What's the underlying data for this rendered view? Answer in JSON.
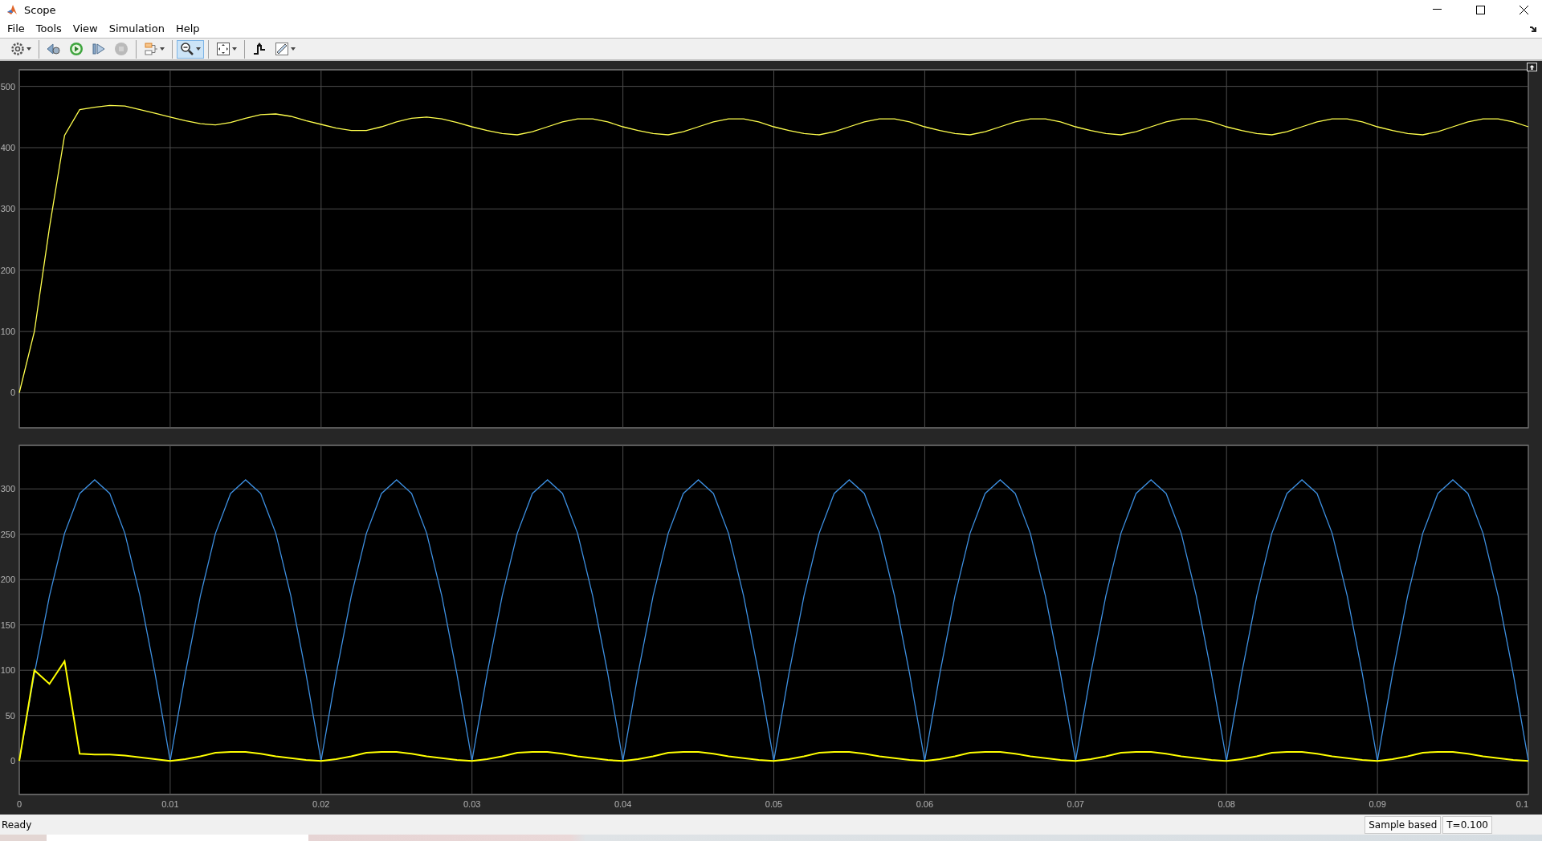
{
  "window": {
    "title": "Scope"
  },
  "menu": [
    "File",
    "Tools",
    "View",
    "Simulation",
    "Help"
  ],
  "toolbar_groups": [
    {
      "items": [
        {
          "kind": "settings",
          "dropdown": true,
          "selected": false,
          "disabled": false
        }
      ]
    },
    {
      "items": [
        {
          "kind": "step-back",
          "dropdown": false,
          "selected": false,
          "disabled": false
        },
        {
          "kind": "run",
          "dropdown": false,
          "selected": false,
          "disabled": false
        },
        {
          "kind": "step-forward",
          "dropdown": false,
          "selected": false,
          "disabled": false
        },
        {
          "kind": "stop",
          "dropdown": false,
          "selected": false,
          "disabled": true
        }
      ]
    },
    {
      "items": [
        {
          "kind": "signal-select",
          "dropdown": true,
          "selected": false,
          "disabled": false
        }
      ]
    },
    {
      "items": [
        {
          "kind": "zoom",
          "dropdown": true,
          "selected": true,
          "disabled": false
        }
      ]
    },
    {
      "items": [
        {
          "kind": "fit",
          "dropdown": true,
          "selected": false,
          "disabled": false
        }
      ]
    },
    {
      "items": [
        {
          "kind": "triggers",
          "dropdown": false,
          "selected": false,
          "disabled": false
        },
        {
          "kind": "measure",
          "dropdown": true,
          "selected": false,
          "disabled": false
        }
      ]
    }
  ],
  "plots": [
    {
      "chart_data": {
        "type": "line",
        "grid": true,
        "xlim": [
          0,
          0.1
        ],
        "ylim": [
          -57,
          527
        ],
        "yticks": [
          0,
          100,
          200,
          300,
          400,
          500
        ],
        "x": [
          0,
          0.001,
          0.002,
          0.003,
          0.004,
          0.005,
          0.006,
          0.007,
          0.008,
          0.009,
          0.01,
          0.011,
          0.012,
          0.013,
          0.014,
          0.015,
          0.016,
          0.017,
          0.018,
          0.019,
          0.02,
          0.021,
          0.022,
          0.023,
          0.024,
          0.025,
          0.026,
          0.027,
          0.028,
          0.029,
          0.03,
          0.031,
          0.032,
          0.033,
          0.034,
          0.035,
          0.036,
          0.037,
          0.038,
          0.039,
          0.04,
          0.041,
          0.042,
          0.043,
          0.044,
          0.045,
          0.046,
          0.047,
          0.048,
          0.049,
          0.05,
          0.051,
          0.052,
          0.053,
          0.054,
          0.055,
          0.056,
          0.057,
          0.058,
          0.059,
          0.06,
          0.061,
          0.062,
          0.063,
          0.064,
          0.065,
          0.066,
          0.067,
          0.068,
          0.069,
          0.07,
          0.071,
          0.072,
          0.073,
          0.074,
          0.075,
          0.076,
          0.077,
          0.078,
          0.079,
          0.08,
          0.081,
          0.082,
          0.083,
          0.084,
          0.085,
          0.086,
          0.087,
          0.088,
          0.089,
          0.09,
          0.091,
          0.092,
          0.093,
          0.094,
          0.095,
          0.096,
          0.097,
          0.098,
          0.099,
          0.1
        ],
        "series": [
          {
            "color": "#ffff4d",
            "values": [
              0,
              100,
              270,
              420,
              462,
              466,
              469,
              468,
              462,
              456,
              450,
              444,
              439,
              437,
              441,
              448,
              454,
              455,
              451,
              444,
              438,
              432,
              428,
              428,
              434,
              442,
              448,
              450,
              447,
              441,
              434,
              428,
              423,
              421,
              426,
              434,
              442,
              447,
              447,
              442,
              434,
              428,
              423,
              421,
              426,
              434,
              442,
              447,
              447,
              442,
              434,
              428,
              423,
              421,
              426,
              434,
              442,
              447,
              447,
              442,
              434,
              428,
              423,
              421,
              426,
              434,
              442,
              447,
              447,
              442,
              434,
              428,
              423,
              421,
              426,
              434,
              442,
              447,
              447,
              442,
              434,
              428,
              423,
              421,
              426,
              434,
              442,
              447,
              447,
              442,
              434,
              428,
              423,
              421,
              426,
              434,
              442,
              447,
              447,
              442,
              434
            ]
          }
        ]
      }
    },
    {
      "chart_data": {
        "type": "line",
        "grid": true,
        "xlim": [
          0,
          0.1
        ],
        "ylim": [
          -37,
          348
        ],
        "yticks": [
          0,
          50,
          100,
          150,
          200,
          250,
          300
        ],
        "xticks": [
          0,
          0.01,
          0.02,
          0.03,
          0.04,
          0.05,
          0.06,
          0.07,
          0.08,
          0.09,
          0.1
        ],
        "x": [
          0,
          0.001,
          0.002,
          0.003,
          0.004,
          0.005,
          0.006,
          0.007,
          0.008,
          0.009,
          0.01,
          0.011,
          0.012,
          0.013,
          0.014,
          0.015,
          0.016,
          0.017,
          0.018,
          0.019,
          0.02,
          0.021,
          0.022,
          0.023,
          0.024,
          0.025,
          0.026,
          0.027,
          0.028,
          0.029,
          0.03,
          0.031,
          0.032,
          0.033,
          0.034,
          0.035,
          0.036,
          0.037,
          0.038,
          0.039,
          0.04,
          0.041,
          0.042,
          0.043,
          0.044,
          0.045,
          0.046,
          0.047,
          0.048,
          0.049,
          0.05,
          0.051,
          0.052,
          0.053,
          0.054,
          0.055,
          0.056,
          0.057,
          0.058,
          0.059,
          0.06,
          0.061,
          0.062,
          0.063,
          0.064,
          0.065,
          0.066,
          0.067,
          0.068,
          0.069,
          0.07,
          0.071,
          0.072,
          0.073,
          0.074,
          0.075,
          0.076,
          0.077,
          0.078,
          0.079,
          0.08,
          0.081,
          0.082,
          0.083,
          0.084,
          0.085,
          0.086,
          0.087,
          0.088,
          0.089,
          0.09,
          0.091,
          0.092,
          0.093,
          0.094,
          0.095,
          0.096,
          0.097,
          0.098,
          0.099,
          0.1
        ],
        "series": [
          {
            "color": "#3d8fe0",
            "values": [
              0,
              96,
              182,
              251,
              295,
              310,
              295,
              251,
              182,
              96,
              0,
              96,
              182,
              251,
              295,
              310,
              295,
              251,
              182,
              96,
              0,
              96,
              182,
              251,
              295,
              310,
              295,
              251,
              182,
              96,
              0,
              96,
              182,
              251,
              295,
              310,
              295,
              251,
              182,
              96,
              0,
              96,
              182,
              251,
              295,
              310,
              295,
              251,
              182,
              96,
              0,
              96,
              182,
              251,
              295,
              310,
              295,
              251,
              182,
              96,
              0,
              96,
              182,
              251,
              295,
              310,
              295,
              251,
              182,
              96,
              0,
              96,
              182,
              251,
              295,
              310,
              295,
              251,
              182,
              96,
              0,
              96,
              182,
              251,
              295,
              310,
              295,
              251,
              182,
              96,
              0,
              96,
              182,
              251,
              295,
              310,
              295,
              251,
              182,
              96,
              0
            ]
          },
          {
            "color": "#ffff00",
            "values": [
              0,
              100,
              85,
              110,
              8,
              7,
              7,
              6,
              4,
              2,
              0,
              2,
              5,
              9,
              10,
              10,
              8,
              5,
              3,
              1,
              0,
              2,
              5,
              9,
              10,
              10,
              8,
              5,
              3,
              1,
              0,
              2,
              5,
              9,
              10,
              10,
              8,
              5,
              3,
              1,
              0,
              2,
              5,
              9,
              10,
              10,
              8,
              5,
              3,
              1,
              0,
              2,
              5,
              9,
              10,
              10,
              8,
              5,
              3,
              1,
              0,
              2,
              5,
              9,
              10,
              10,
              8,
              5,
              3,
              1,
              0,
              2,
              5,
              9,
              10,
              10,
              8,
              5,
              3,
              1,
              0,
              2,
              5,
              9,
              10,
              10,
              8,
              5,
              3,
              1,
              0,
              2,
              5,
              9,
              10,
              10,
              8,
              5,
              3,
              1,
              0
            ]
          }
        ]
      }
    }
  ],
  "status_bar": {
    "message": "Ready",
    "fields": [
      "Sample based",
      "T=0.100"
    ]
  }
}
